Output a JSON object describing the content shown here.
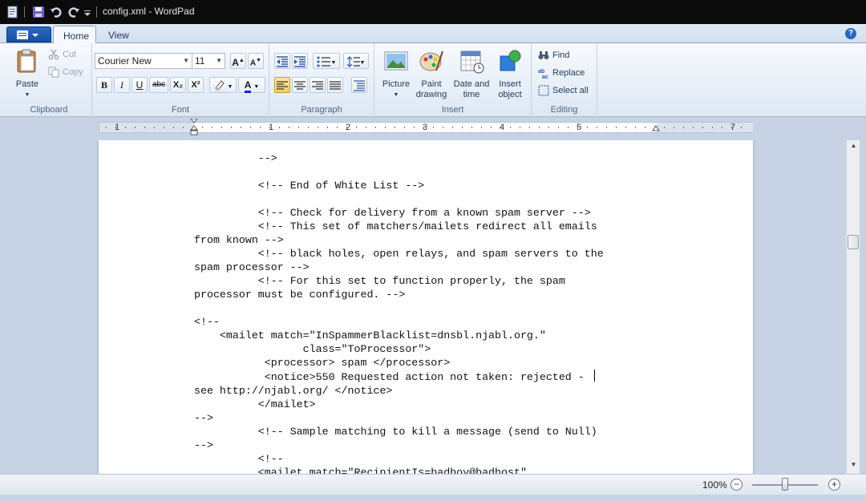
{
  "window": {
    "title": "config.xml - WordPad"
  },
  "tabs": {
    "home": "Home",
    "view": "View"
  },
  "help": "?",
  "clipboard": {
    "group": "Clipboard",
    "paste": "Paste",
    "cut": "Cut",
    "copy": "Copy"
  },
  "font": {
    "group": "Font",
    "family": "Courier New",
    "size": "11",
    "bold": "B",
    "italic": "I",
    "underline": "U",
    "strike": "abc",
    "subscript": "X₂",
    "superscript": "X²",
    "grow": "A",
    "shrink": "A",
    "color_a": "A"
  },
  "paragraph": {
    "group": "Paragraph"
  },
  "insert": {
    "group": "Insert",
    "picture": "Picture",
    "paint1": "Paint",
    "paint2": "drawing",
    "date1": "Date and",
    "date2": "time",
    "obj1": "Insert",
    "obj2": "object"
  },
  "editing": {
    "group": "Editing",
    "find": "Find",
    "replace": "Replace",
    "select_all": "Select all"
  },
  "ruler": {
    "numbers": [
      "1",
      "1",
      "2",
      "3",
      "4",
      "5",
      "7"
    ]
  },
  "document": {
    "lines": [
      "          -->",
      "",
      "          <!-- End of White List -->",
      "",
      "          <!-- Check for delivery from a known spam server -->",
      "          <!-- This set of matchers/mailets redirect all emails",
      "from known -->",
      "          <!-- black holes, open relays, and spam servers to the",
      "spam processor -->",
      "          <!-- For this set to function properly, the spam",
      "processor must be configured. -->",
      "",
      "<!--",
      "    <mailet match=\"InSpammerBlacklist=dnsbl.njabl.org.\"",
      "                 class=\"ToProcessor\">",
      "           <processor> spam </processor>",
      "           <notice>550 Requested action not taken: rejected - ",
      "see http://njabl.org/ </notice>",
      "          </mailet>",
      "-->",
      "          <!-- Sample matching to kill a message (send to Null)",
      "-->",
      "          <!--",
      "          <mailet match=\"RecipientIs=badboy@badhost\""
    ]
  },
  "status": {
    "zoom": "100%",
    "zoom_out": "−",
    "zoom_in": "+"
  }
}
